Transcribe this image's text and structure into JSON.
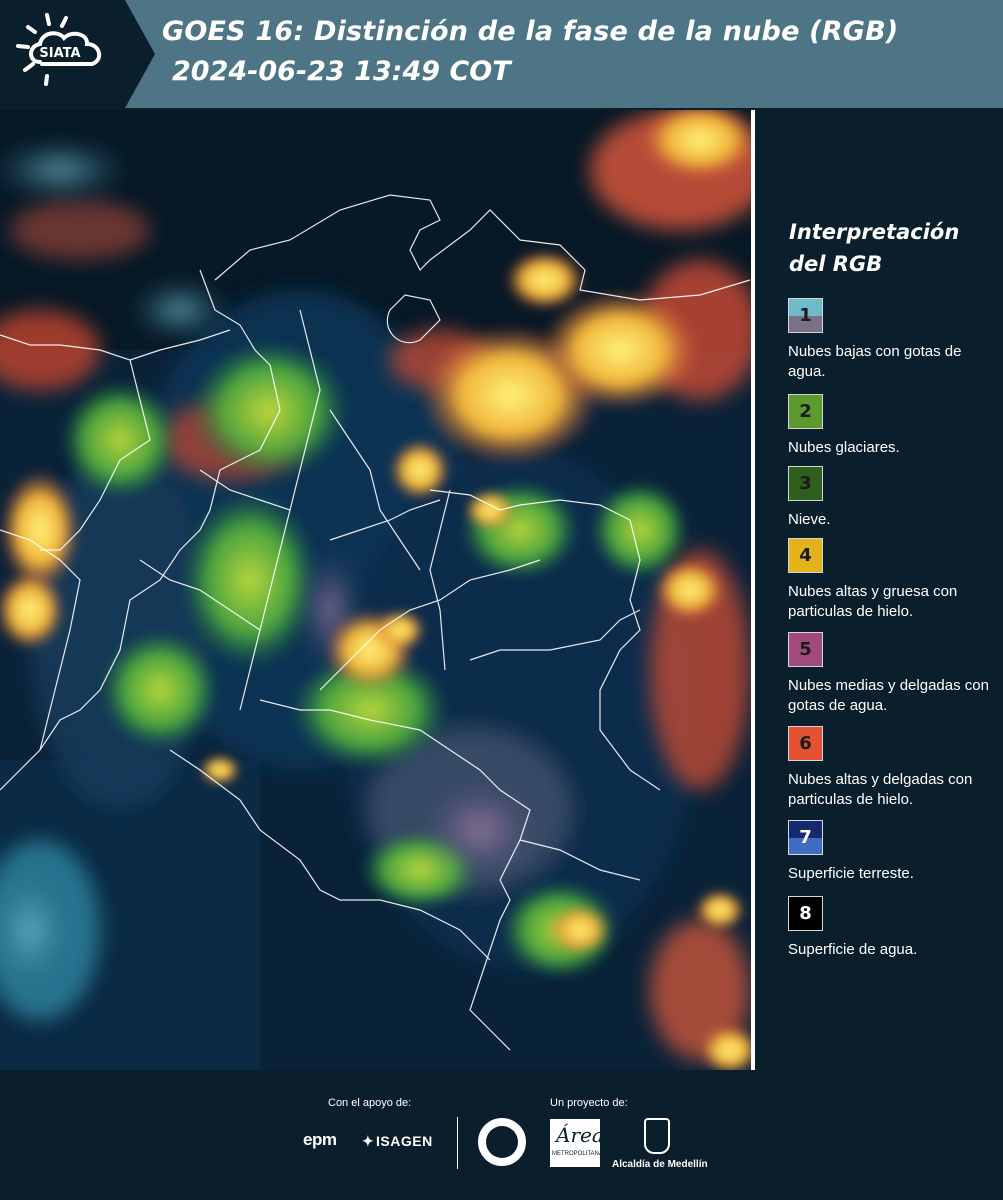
{
  "header": {
    "logo_text": "SIATA",
    "title_line1": "GOES 16: Distinción de la fase de la nube (RGB)",
    "title_line2": "2024-06-23 13:49 COT",
    "background_color": "#4e7585"
  },
  "map": {
    "icon": "satellite-map-image",
    "boundary_color": "#ffffff"
  },
  "legend": {
    "title_line1": "Interpretación",
    "title_line2": "del RGB",
    "items": [
      {
        "number": "1",
        "label": "Nubes bajas con gotas de agua.",
        "color_top": "#6fb9c8",
        "color_bottom": "#7a7187"
      },
      {
        "number": "2",
        "label": "Nubes glaciares.",
        "color_top": "#5d9a2e",
        "color_bottom": "#5d9a2e"
      },
      {
        "number": "3",
        "label": "Nieve.",
        "color_top": "#2f5f1c",
        "color_bottom": "#2f5f1c"
      },
      {
        "number": "4",
        "label": "Nubes altas y gruesa con particulas de hielo.",
        "color_top": "#e2b31b",
        "color_bottom": "#e2b31b"
      },
      {
        "number": "5",
        "label": "Nubes medias y delgadas con gotas de agua.",
        "color_top": "#a14b7c",
        "color_bottom": "#a14b7c"
      },
      {
        "number": "6",
        "label": "Nubes altas y delgadas con particulas de hielo.",
        "color_top": "#e55233",
        "color_bottom": "#e55233"
      },
      {
        "number": "7",
        "label": "Superficie terreste.",
        "color_top": "#142a6c",
        "color_bottom": "#3f6cc1"
      },
      {
        "number": "8",
        "label": "Superficie de agua.",
        "color_top": "#000000",
        "color_bottom": "#000000"
      }
    ]
  },
  "footer": {
    "support_label": "Con el apoyo de:",
    "project_label": "Un proyecto de:",
    "sponsor1": "epm",
    "sponsor2": "ISAGEN",
    "area_logo_letter": "Área",
    "area_logo_sub": "METROPOLITANA",
    "alcaldia": "Alcaldía de Medellín"
  }
}
